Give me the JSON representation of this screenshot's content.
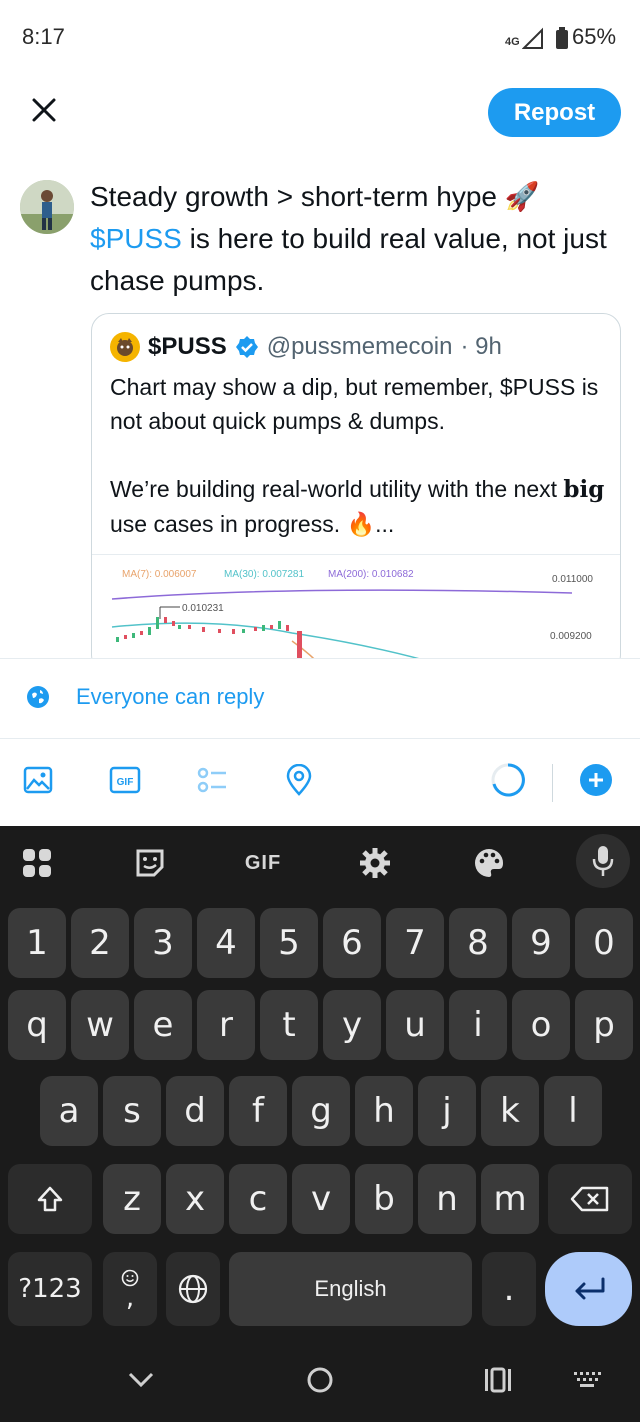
{
  "status_bar": {
    "time": "8:17",
    "network": "4G",
    "battery": "65%"
  },
  "header": {
    "close_icon": "close-icon",
    "repost_label": "Repost"
  },
  "composer": {
    "text_part1": "Steady growth > short-term hype ",
    "emoji_rocket": "🚀",
    "cashtag": "$PUSS",
    "text_part2": " is here to build real value, not just chase pumps."
  },
  "quote": {
    "name": "$PUSS",
    "handle": "@pussmemecoin",
    "time": "· 9h",
    "body": "Chart may show a dip, but remember, $PUSS is not about quick pumps & dumps.\n\nWe’re building real-world utility with the next ",
    "body_bold": "big",
    "body_end": " use cases in progress. 🔥...",
    "chart": {
      "ma7": "MA(7): 0.006007",
      "ma30": "MA(30): 0.007281",
      "ma200": "MA(200): 0.010682",
      "price_label": "0.010231",
      "axis_top": "0.011000",
      "axis_mid": "0.009200"
    }
  },
  "reply_setting": {
    "icon": "globe-icon",
    "label": "Everyone can reply"
  },
  "toolbar": {
    "icons": [
      "image-icon",
      "gif-icon",
      "poll-icon",
      "location-icon",
      "progress-ring-icon",
      "add-post-icon"
    ],
    "gif_label": "GIF"
  },
  "keyboard": {
    "top_row": [
      "apps-grid-icon",
      "sticker-icon",
      "GIF",
      "settings-icon",
      "palette-icon",
      "mic-icon"
    ],
    "numbers": [
      "1",
      "2",
      "3",
      "4",
      "5",
      "6",
      "7",
      "8",
      "9",
      "0"
    ],
    "row1": [
      "q",
      "w",
      "e",
      "r",
      "t",
      "y",
      "u",
      "i",
      "o",
      "p"
    ],
    "row2": [
      "a",
      "s",
      "d",
      "f",
      "g",
      "h",
      "j",
      "k",
      "l"
    ],
    "row3": [
      "z",
      "x",
      "c",
      "v",
      "b",
      "n",
      "m"
    ],
    "symbols_key": "?123",
    "emoji_comma": ",",
    "space_label": "English",
    "period": "."
  },
  "colors": {
    "accent": "#1d9bf0",
    "keyboard_bg": "#1b1b1b",
    "key_bg": "#3a3a3a",
    "enter_bg": "#aecbfa"
  }
}
